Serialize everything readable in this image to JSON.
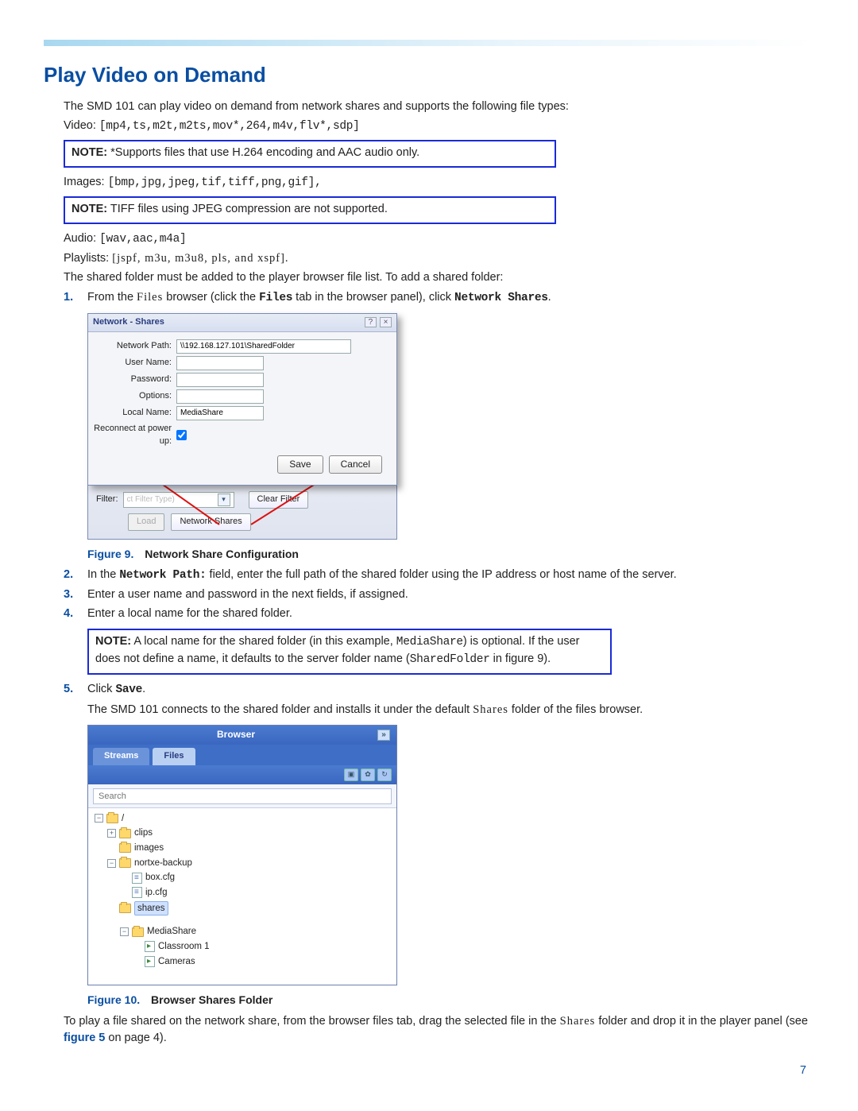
{
  "page_number": "7",
  "section_title": "Play Video on Demand",
  "intro": "The SMD 101 can play video on demand from network shares and supports the following file types:",
  "video_line_label": "Video:",
  "video_line_code": "[mp4,ts,m2t,m2ts,mov*,264,m4v,flv*,sdp]",
  "note1_label": "NOTE:",
  "note1_text": "*Supports files that use H.264 encoding and AAC audio only.",
  "images_line_label": "Images:",
  "images_line_code": "[bmp,jpg,jpeg,tif,tiff,png,gif],",
  "note2_label": "NOTE:",
  "note2_text": "TIFF files using JPEG compression are not supported.",
  "audio_line_label": "Audio:",
  "audio_line_code": "[wav,aac,m4a]",
  "playlists_line_label": "Playlists:",
  "playlists_line_code": "[jspf, m3u, m3u8, pls, and xspf].",
  "shared_folder_text": "The shared folder must be added to the player browser file list. To add a shared folder:",
  "steps_part1": {
    "s1_a": "From the ",
    "s1_b": "Files",
    "s1_c": " browser (click the ",
    "s1_d": "Files",
    "s1_e": " tab in the browser panel), click ",
    "s1_f": "Network Shares",
    "s1_g": "."
  },
  "fig9": {
    "label": "Figure 9.",
    "title": "Network Share Configuration",
    "dlg_title": "Network - Shares",
    "np_label": "Network Path:",
    "np_value": "\\\\192.168.127.101\\SharedFolder",
    "un_label": "User Name:",
    "pw_label": "Password:",
    "opt_label": "Options:",
    "ln_label": "Local Name:",
    "ln_value": "MediaShare",
    "rc_label": "Reconnect at power up:",
    "save": "Save",
    "cancel": "Cancel",
    "filter_label": "Filter:",
    "filter_combo": "ct Filter Type)",
    "clear": "Clear Filter",
    "load": "Load",
    "ns": "Network Shares"
  },
  "steps_part2": {
    "s2_a": "In the ",
    "s2_b": "Network Path:",
    "s2_c": " field, enter the full path of the shared folder using the IP address or host name of the server.",
    "s3": "Enter a user name and password in the next fields, if assigned.",
    "s4": "Enter a local name for the shared folder."
  },
  "note3_label": "NOTE:",
  "note3_a": "A local name for the shared folder (in this example, ",
  "note3_b": "MediaShare",
  "note3_c": ") is optional. If the user does not define a name, it defaults to the server folder name (",
  "note3_d": "SharedFolder",
  "note3_e": " in figure 9).",
  "steps_part3": {
    "s5_a": "Click ",
    "s5_b": "Save",
    "s5_c": ".",
    "s5_after_a": "The SMD 101 connects to the shared folder and installs it under the default ",
    "s5_after_b": "Shares",
    "s5_after_c": " folder of the files browser."
  },
  "fig10": {
    "label": "Figure 10.",
    "title": "Browser Shares Folder",
    "panel_title": "Browser",
    "tab_streams": "Streams",
    "tab_files": "Files",
    "search_placeholder": "Search",
    "root": "/",
    "clips": "clips",
    "images": "images",
    "nortxe": "nortxe-backup",
    "boxcfg": "box.cfg",
    "ipcfg": "ip.cfg",
    "shares": "shares",
    "mediashare": "MediaShare",
    "classroom": "Classroom 1",
    "cameras": "Cameras"
  },
  "final_a": "To play a file shared on the network share, from the browser files tab, drag the selected file in the ",
  "final_b": "Shares",
  "final_c": " folder and drop it in the player panel (see ",
  "final_link": "figure 5",
  "final_d": " on page 4)."
}
